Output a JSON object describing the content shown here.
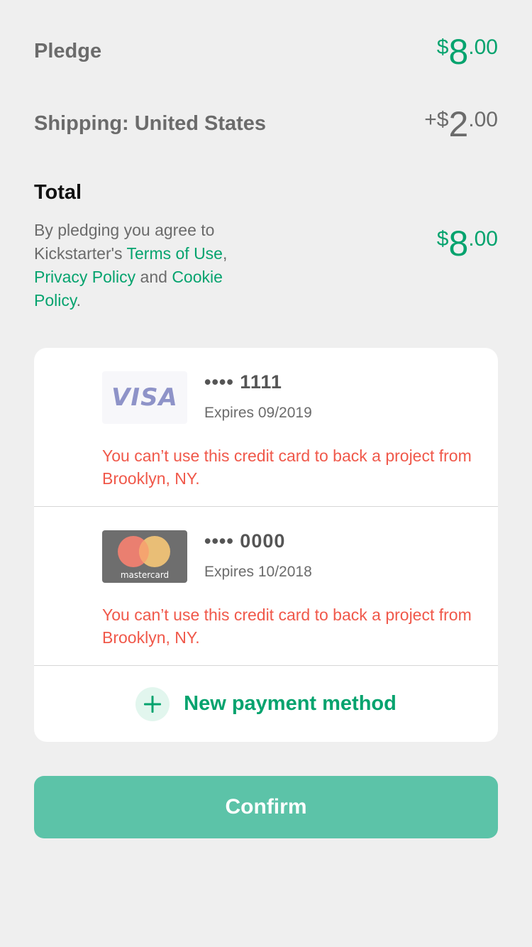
{
  "pledge": {
    "label": "Pledge",
    "currency": "$",
    "amount_major": "8",
    "amount_minor": ".00"
  },
  "shipping": {
    "label": "Shipping: United States",
    "prefix": "+$",
    "amount_major": "2",
    "amount_minor": ".00"
  },
  "total": {
    "label": "Total",
    "currency": "$",
    "amount_major": "8",
    "amount_minor": ".00",
    "terms": {
      "text_1": "By pledging you agree to Kickstarter's ",
      "terms_link": "Terms of Use",
      "text_2": ", ",
      "privacy_link": "Privacy Policy",
      "text_3": " and ",
      "cookie_link": "Cookie Policy",
      "text_4": "."
    }
  },
  "cards": [
    {
      "brand": "VISA",
      "number": "•••• 1111",
      "expires": "Expires 09/2019",
      "error": "You can’t use this credit card to back a project from Brooklyn, NY."
    },
    {
      "brand": "mastercard",
      "number": "•••• 0000",
      "expires": "Expires 10/2018",
      "error": "You can’t use this credit card to back a project from Brooklyn, NY."
    }
  ],
  "new_payment": {
    "label": "New payment method",
    "icon": "plus-icon"
  },
  "confirm": {
    "label": "Confirm"
  },
  "colors": {
    "accent": "#05a36e",
    "error": "#f0584a",
    "confirm_bg": "#5cc3a8",
    "background": "#efefef"
  }
}
